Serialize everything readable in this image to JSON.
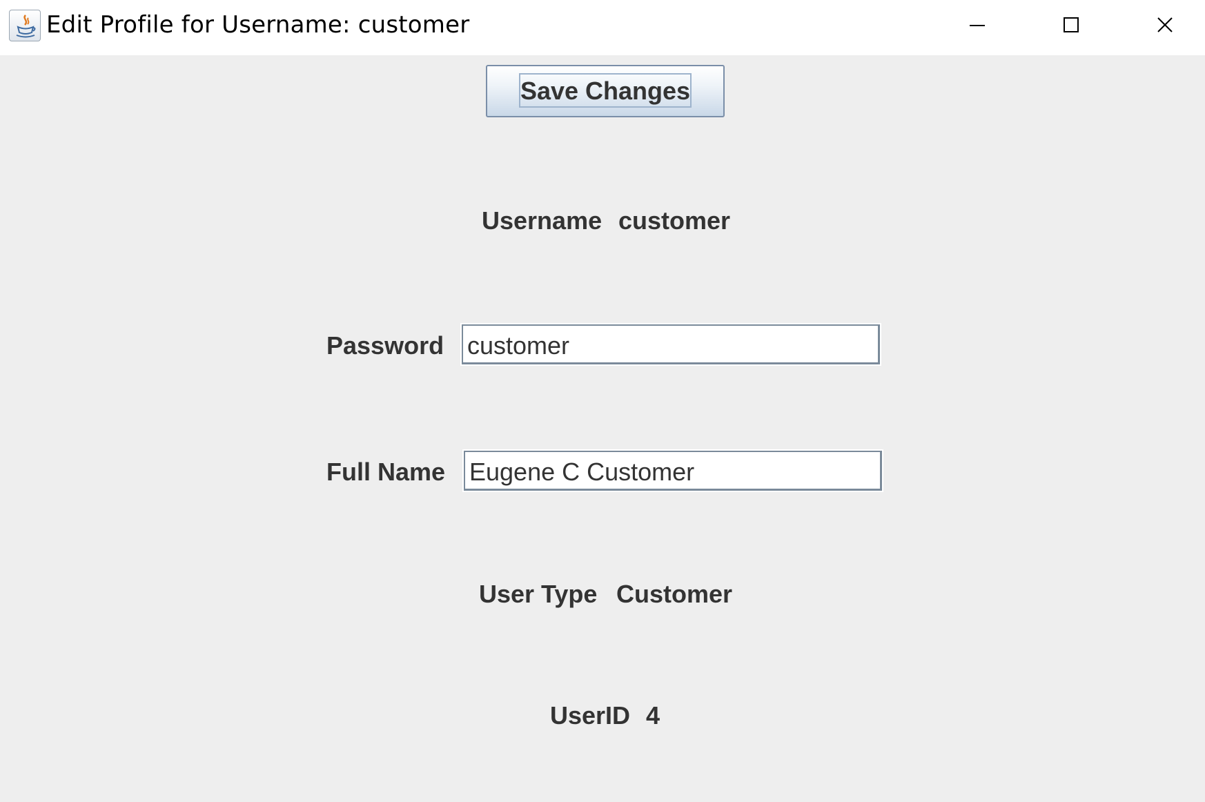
{
  "window": {
    "title": "Edit Profile for Username: customer",
    "icon": "java-cup-icon"
  },
  "toolbar": {
    "save_label": "Save Changes"
  },
  "form": {
    "username_label": "Username",
    "username_value": "customer",
    "password_label": "Password",
    "password_value": "customer",
    "fullname_label": "Full Name",
    "fullname_value": "Eugene C Customer",
    "usertype_label": "User Type",
    "usertype_value": "Customer",
    "userid_label": "UserID",
    "userid_value": "4"
  },
  "colors": {
    "background": "#eeeeee",
    "text": "#333333",
    "button_border": "#7a8ea8"
  }
}
